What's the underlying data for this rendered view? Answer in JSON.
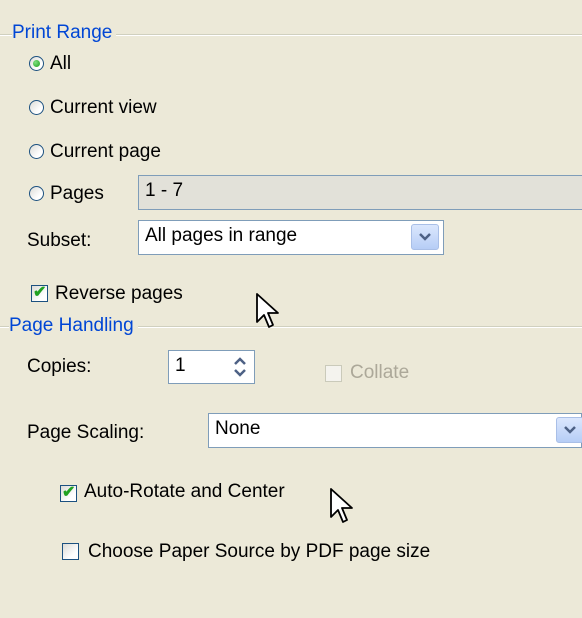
{
  "print_range": {
    "title": "Print Range",
    "options": [
      {
        "label": "All",
        "selected": true
      },
      {
        "label": "Current view",
        "selected": false
      },
      {
        "label": "Current page",
        "selected": false
      },
      {
        "label": "Pages",
        "selected": false
      }
    ],
    "pages_value": "1 - 7",
    "subset_label": "Subset:",
    "subset_value": "All pages in range",
    "reverse_pages_label": "Reverse pages",
    "reverse_pages_checked": true
  },
  "page_handling": {
    "title": "Page Handling",
    "copies_label": "Copies:",
    "copies_value": "1",
    "collate_label": "Collate",
    "collate_enabled": false,
    "page_scaling_label": "Page Scaling:",
    "page_scaling_value": "None",
    "auto_rotate_label": "Auto-Rotate and Center",
    "auto_rotate_checked": true,
    "paper_source_label": "Choose Paper Source by PDF page size",
    "paper_source_checked": false
  },
  "icons": {
    "radio_selected": "radio-selected-icon",
    "dropdown": "chevron-down-icon",
    "spinner": "up-down-arrows-icon",
    "cursor": "mouse-pointer-icon"
  },
  "colors": {
    "group_title": "#0046d5",
    "background": "#ece9d8",
    "check_green": "#21a121"
  }
}
